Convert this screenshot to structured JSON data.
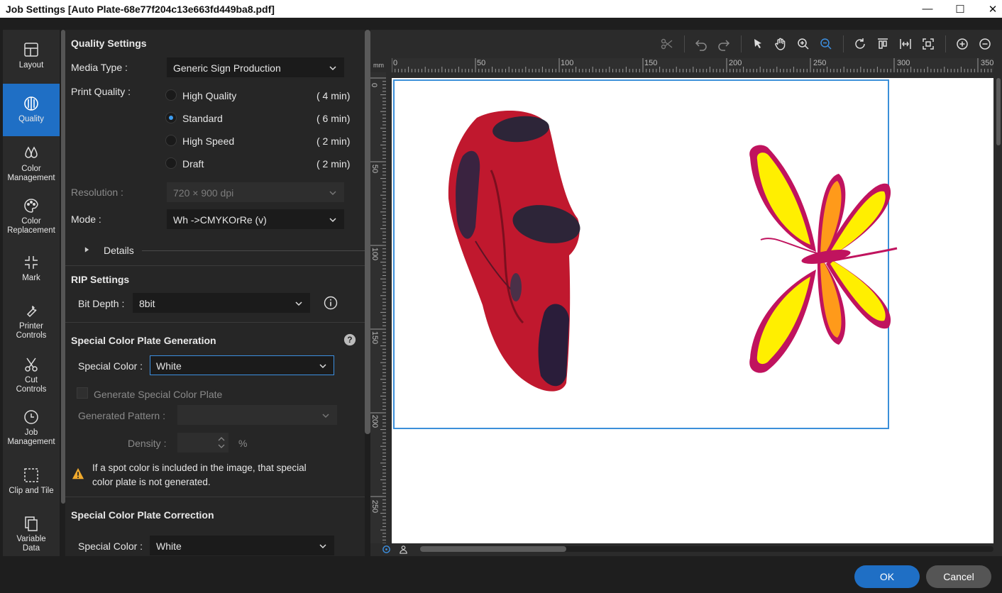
{
  "window": {
    "title": "Job Settings [Auto Plate-68e77f204c13e663fd449ba8.pdf]"
  },
  "sidebar": {
    "items": [
      {
        "label": "Layout"
      },
      {
        "label": "Quality"
      },
      {
        "label": "Color Management"
      },
      {
        "label": "Color Replacement"
      },
      {
        "label": "Mark"
      },
      {
        "label": "Printer Controls"
      },
      {
        "label": "Cut Controls"
      },
      {
        "label": "Job Management"
      },
      {
        "label": "Clip and Tile"
      },
      {
        "label": "Variable Data"
      }
    ],
    "active": "Quality"
  },
  "quality": {
    "title": "Quality Settings",
    "media_label": "Media Type :",
    "media_value": "Generic Sign Production",
    "print_quality_label": "Print Quality :",
    "options": [
      {
        "label": "High Quality",
        "time": "( 4 min)"
      },
      {
        "label": "Standard",
        "time": "( 6 min)"
      },
      {
        "label": "High Speed",
        "time": "( 2 min)"
      },
      {
        "label": "Draft",
        "time": "( 2 min)"
      }
    ],
    "selected": "Standard",
    "resolution_label": "Resolution :",
    "resolution_value": "720 × 900 dpi",
    "mode_label": "Mode :",
    "mode_value": "Wh ->CMYKOrRe (v)",
    "details_label": "Details"
  },
  "rip": {
    "title": "RIP Settings",
    "bit_depth_label": "Bit Depth :",
    "bit_depth_value": "8bit"
  },
  "special_gen": {
    "title": "Special Color Plate Generation",
    "special_color_label": "Special Color :",
    "special_color_value": "White",
    "generate_label": "Generate Special Color Plate",
    "pattern_label": "Generated Pattern :",
    "density_label": "Density :",
    "density_unit": "%",
    "warning_line1": "If a spot color is included in the image, that special",
    "warning_line2": "color plate is not generated."
  },
  "special_corr": {
    "title": "Special Color Plate Correction",
    "special_color_label": "Special Color :",
    "special_color_value": "White"
  },
  "ruler": {
    "h_labels": [
      "0",
      "50",
      "100",
      "150",
      "200",
      "250",
      "300",
      "350"
    ],
    "v_labels": [
      "0",
      "50",
      "100",
      "150",
      "200",
      "250"
    ],
    "unit": "mm"
  },
  "footer": {
    "ok_label": "OK",
    "cancel_label": "Cancel"
  },
  "colors": {
    "accent": "#1f6fc5",
    "focus": "#3c8fe0",
    "page_border": "#3b8fd9"
  }
}
